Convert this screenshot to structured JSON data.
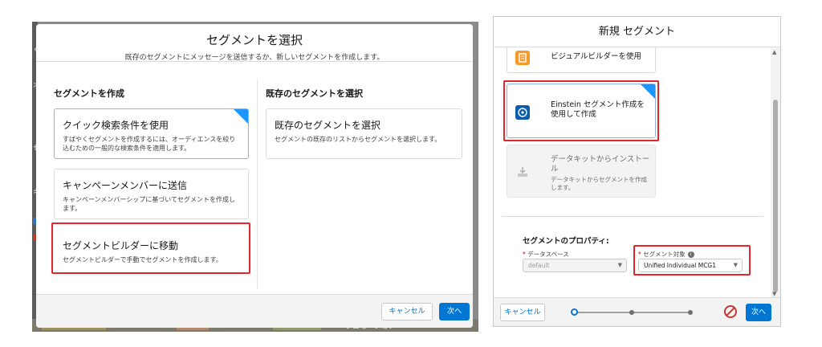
{
  "left": {
    "title": "セグメントを選択",
    "subtitle": "既存のセグメントにメッセージを送信するか、新しいセグメントを作成します。",
    "create_column_title": "セグメントを作成",
    "existing_column_title": "既存のセグメントを選択",
    "cards": [
      {
        "title": "クイック検索条件を使用",
        "desc": "すばやくセグメントを作成するには、オーディエンスを絞り込むための一般的な検索条件を適用します。",
        "selected": true
      },
      {
        "title": "キャンペーンメンバーに送信",
        "desc": "キャンペーンメンバーシップに基づいてセグメントを作成します。",
        "selected": false
      },
      {
        "title": "セグメントビルダーに移動",
        "desc": "セグメントビルダーで手動でセグメントを作成します。",
        "selected": false,
        "highlighted": true
      }
    ],
    "existing_card": {
      "title": "既存のセグメントを選択",
      "desc": "セグメントの既存のリストからセグメントを選択します。"
    },
    "footer": {
      "cancel_label": "キャンセル",
      "next_label": "次へ"
    },
    "background_text": "プロモーション"
  },
  "right": {
    "title": "新規 セグメント",
    "cards": [
      {
        "title": "ビジュアルビルダーを使用",
        "icon": "builder-icon",
        "icon_color": "#f59b2a"
      },
      {
        "title": "Einstein セグメント作成を使用して作成",
        "icon": "einstein-icon",
        "icon_color": "#0b5cab",
        "selected": true,
        "highlighted": true
      },
      {
        "title": "データキットからインストール",
        "desc": "データキットからセグメントを作成します。",
        "icon": "download-icon",
        "disabled": true
      }
    ],
    "properties_title": "セグメントのプロパティ:",
    "fields": {
      "dataspace_label": "データスペース",
      "dataspace_value": "default",
      "target_label": "セグメント対象",
      "target_value": "Unified Individual MCG1"
    },
    "footer": {
      "cancel_label": "キャンセル",
      "next_label": "次へ",
      "current_step": 1,
      "total_steps": 3
    }
  },
  "colors": {
    "brand": "#0176d3",
    "highlight": "#e3262c",
    "selected_corner": "#1b96ff"
  }
}
